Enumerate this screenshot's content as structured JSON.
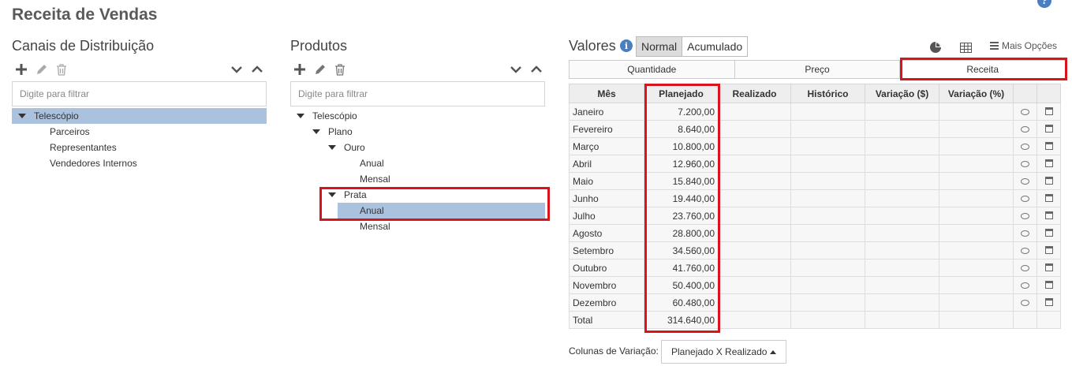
{
  "page": {
    "title": "Receita de Vendas"
  },
  "canais": {
    "title": "Canais de Distribuição",
    "filter_placeholder": "Digite para filtrar",
    "tree": [
      {
        "label": "Telescópio",
        "level": 0,
        "expanded": true,
        "selected": true
      },
      {
        "label": "Parceiros",
        "level": 2
      },
      {
        "label": "Representantes",
        "level": 2
      },
      {
        "label": "Vendedores Internos",
        "level": 2
      }
    ]
  },
  "produtos": {
    "title": "Produtos",
    "filter_placeholder": "Digite para filtrar",
    "tree": [
      {
        "label": "Telescópio",
        "level": 0,
        "expanded": true
      },
      {
        "label": "Plano",
        "level": 1,
        "expanded": true
      },
      {
        "label": "Ouro",
        "level": 2,
        "expanded": true
      },
      {
        "label": "Anual",
        "level": 3
      },
      {
        "label": "Mensal",
        "level": 3
      },
      {
        "label": "Prata",
        "level": 2,
        "expanded": true
      },
      {
        "label": "Anual",
        "level": 3,
        "selected": true
      },
      {
        "label": "Mensal",
        "level": 3
      }
    ]
  },
  "valores": {
    "title": "Valores",
    "toggle_normal": "Normal",
    "toggle_acumulado": "Acumulado",
    "mais_opcoes": "Mais Opções",
    "tabs": [
      "Quantidade",
      "Preço",
      "Receita"
    ],
    "columns": [
      "Mês",
      "Planejado",
      "Realizado",
      "Histórico",
      "Variação ($)",
      "Variação (%)"
    ],
    "rows": [
      {
        "mes": "Janeiro",
        "planejado": "7.200,00"
      },
      {
        "mes": "Fevereiro",
        "planejado": "8.640,00"
      },
      {
        "mes": "Março",
        "planejado": "10.800,00"
      },
      {
        "mes": "Abril",
        "planejado": "12.960,00"
      },
      {
        "mes": "Maio",
        "planejado": "15.840,00"
      },
      {
        "mes": "Junho",
        "planejado": "19.440,00"
      },
      {
        "mes": "Julho",
        "planejado": "23.760,00"
      },
      {
        "mes": "Agosto",
        "planejado": "28.800,00"
      },
      {
        "mes": "Setembro",
        "planejado": "34.560,00"
      },
      {
        "mes": "Outubro",
        "planejado": "41.760,00"
      },
      {
        "mes": "Novembro",
        "planejado": "50.400,00"
      },
      {
        "mes": "Dezembro",
        "planejado": "60.480,00"
      }
    ],
    "total": {
      "mes": "Total",
      "planejado": "314.640,00"
    },
    "variacao_label": "Colunas de Variação:",
    "variacao_value": "Planejado X Realizado"
  },
  "colors": {
    "highlight": "#d8141c",
    "selected": "#abc2de",
    "help": "#4a7fc1"
  },
  "icons": [
    "help-icon",
    "plus-icon",
    "pencil-icon",
    "trash-icon",
    "chevron-down-icon",
    "chevron-up-icon",
    "info-icon",
    "pie-chart-icon",
    "table-icon",
    "menu-icon",
    "comment-icon",
    "calendar-icon"
  ]
}
